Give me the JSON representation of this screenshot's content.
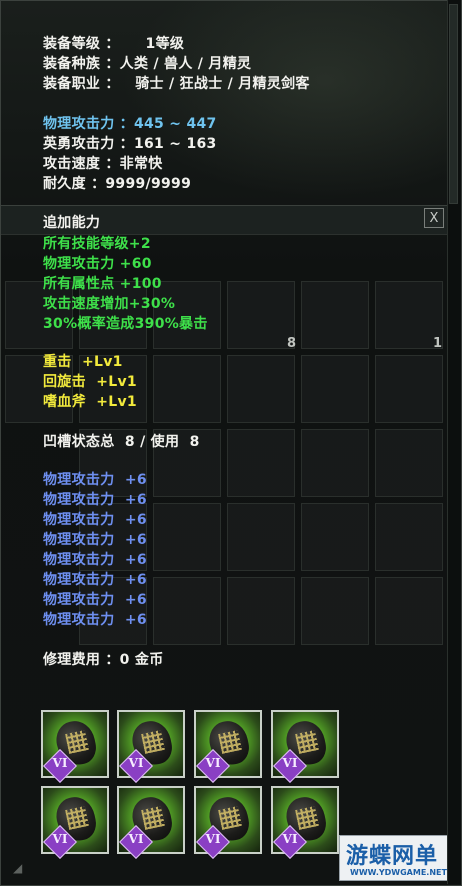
{
  "equip_info": {
    "level": "装备等级 ：     1等级",
    "race": "装备种族 ：人类 / 兽人 / 月精灵",
    "class": "装备职业 ：   骑士 / 狂战士 / 月精灵剑客"
  },
  "attack_stats": {
    "physical": "物理攻击力 ：445 ~ 447",
    "heroic": "英勇攻击力 ：161 ~ 163",
    "speed": "攻击速度 ：非常快",
    "durability": "耐久度 ：9999/9999"
  },
  "extra_abilities": {
    "header": "追加能力",
    "close_label": "X",
    "green_lines": [
      "所有技能等级+2",
      "物理攻击力 +60",
      "所有属性点 +100",
      "攻击速度增加+30%",
      "30%概率造成390%暴击"
    ],
    "skill_lines": [
      "重击  +Lv1",
      "回旋击  +Lv1",
      "嗜血斧  +Lv1"
    ]
  },
  "sockets": {
    "summary": "凹槽状态总  8 / 使用  8",
    "lines": [
      "物理攻击力  +6",
      "物理攻击力  +6",
      "物理攻击力  +6",
      "物理攻击力  +6",
      "物理攻击力  +6",
      "物理攻击力  +6",
      "物理攻击力  +6",
      "物理攻击力  +6"
    ],
    "gem_label": "VI"
  },
  "repair": "修理费用 ：0 金币",
  "background_counts": [
    "8",
    "1"
  ],
  "watermark": {
    "main": "游蝶网单",
    "sub": "WWW.YDWGAME.NET"
  },
  "colors": {
    "white": "#f2f2ee",
    "cyan": "#6fc3ee",
    "green": "#3ee04a",
    "yellow": "#f2ea3c",
    "blue": "#6e8ff0"
  }
}
